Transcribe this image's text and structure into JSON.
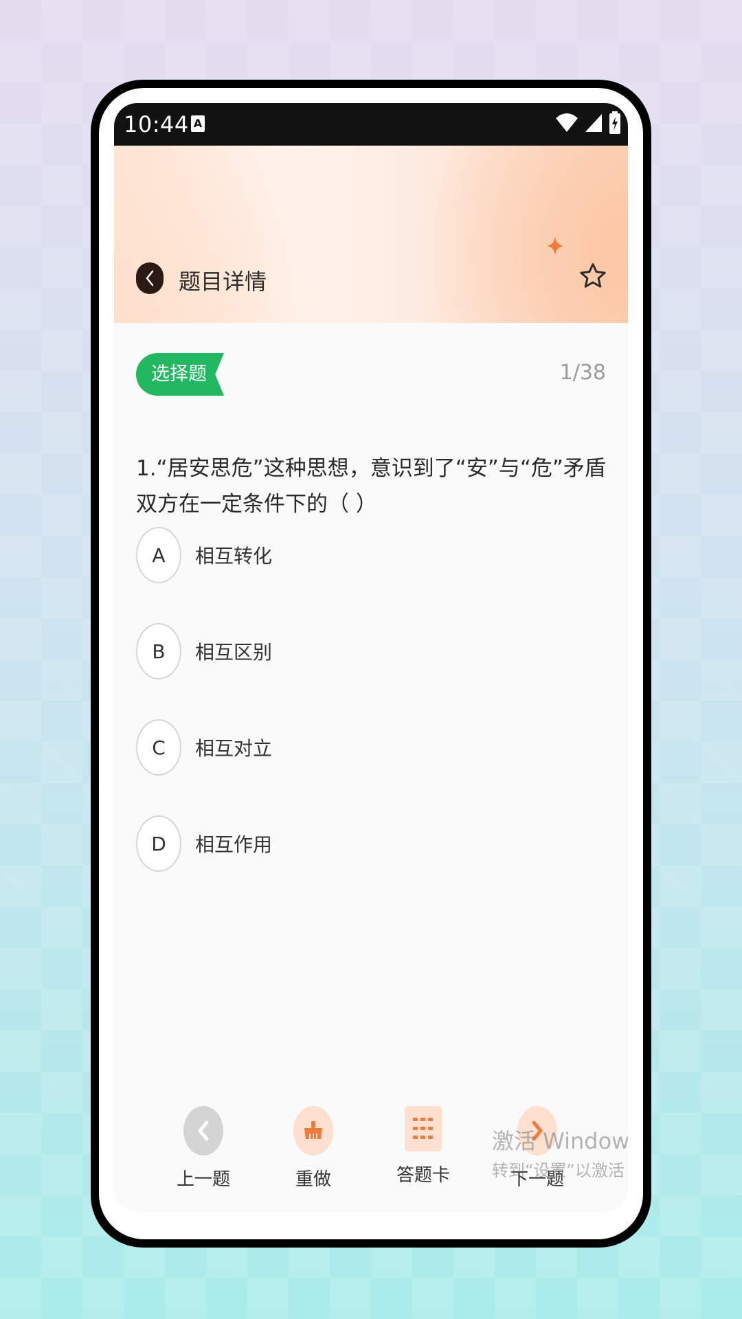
{
  "status": {
    "time": "10:44",
    "badge": "A"
  },
  "header": {
    "title": "题目详情"
  },
  "question": {
    "type": "选择题",
    "progress": "1/38",
    "text": "1.“居安思危”这种思想，意识到了“安”与“危”矛盾双方在一定条件下的（  ）",
    "options": [
      {
        "letter": "A",
        "text": "相互转化"
      },
      {
        "letter": "B",
        "text": "相互区别"
      },
      {
        "letter": "C",
        "text": "相互对立"
      },
      {
        "letter": "D",
        "text": "相互作用"
      }
    ]
  },
  "bottom_nav": {
    "prev": "上一题",
    "redo": "重做",
    "card": "答题卡",
    "next": "下一题"
  },
  "watermark": {
    "line1": "激活 Windows",
    "line2": "转到“设置”以激活 Windows。"
  },
  "colors": {
    "accent_green": "#22b761",
    "accent_orange": "#f07a3a",
    "badge_gray": "#d4d4d4"
  }
}
